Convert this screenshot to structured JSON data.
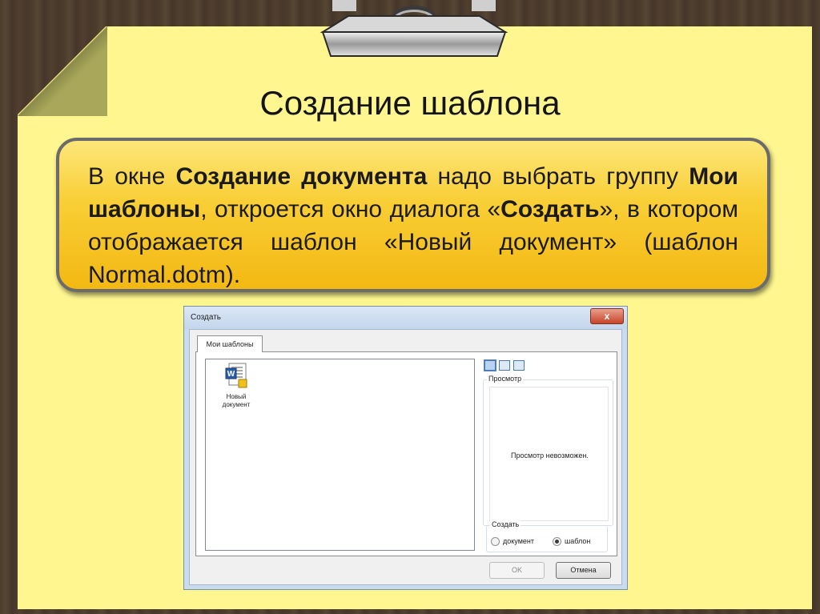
{
  "slide": {
    "title": "Создание шаблона",
    "callout": {
      "t1": "В окне ",
      "b1": "Создание документа",
      "t2": " надо выбрать группу ",
      "b2": "Мои шаблоны",
      "t3": ", откроется окно диалога «",
      "b3": "Создать",
      "t4": "», в котором отображается шаблон «Новый документ» (шаблон Normal.dotm)."
    }
  },
  "dialog": {
    "title": "Создать",
    "close_label": "x",
    "tabs": [
      {
        "label": "Мои шаблоны",
        "selected": true
      }
    ],
    "templates": [
      {
        "line1": "Новый",
        "line2": "документ",
        "icon": "word-document-icon"
      }
    ],
    "view_buttons": [
      "large-icons-view-icon",
      "list-view-icon",
      "details-view-icon"
    ],
    "preview": {
      "label": "Просмотр",
      "message": "Просмотр невозможен."
    },
    "create_group": {
      "label": "Создать",
      "options": [
        {
          "label": "документ",
          "selected": false
        },
        {
          "label": "шаблон",
          "selected": true
        }
      ]
    },
    "buttons": {
      "ok": "OK",
      "cancel": "Отмена"
    },
    "colors": {
      "paper": "#fff68f",
      "callout_top": "#fde67a",
      "callout_bottom": "#f3b812",
      "dialog_frame": "#c9dbee"
    }
  }
}
